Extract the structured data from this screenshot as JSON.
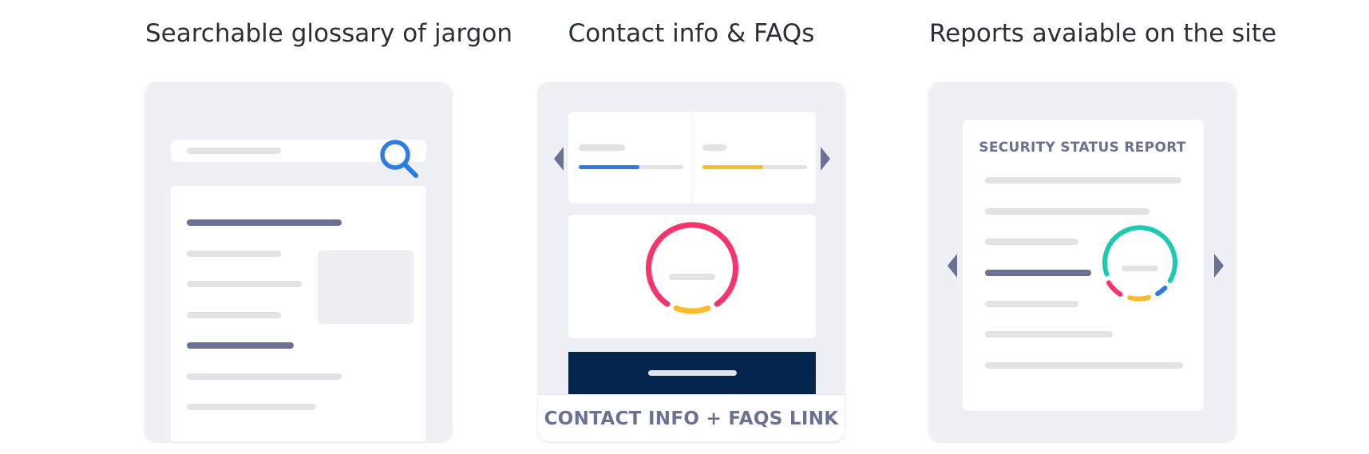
{
  "columns": [
    {
      "title": "Searchable glossary of jargon"
    },
    {
      "title": "Contact info & FAQs",
      "label": "CONTACT INFO + FAQS LINK"
    },
    {
      "title": "Reports avaiable on the site",
      "report_title": "SECURITY STATUS REPORT"
    }
  ],
  "icons": [
    "search-icon",
    "arrow-left-icon",
    "arrow-right-icon",
    "donut-gauge-icon"
  ],
  "colors": {
    "card_bg": "#eef0f5",
    "placeholder_light": "#e1e3e4",
    "placeholder_dark": "#6a7193",
    "blue": "#2f7be5",
    "yellow": "#fbbb2a",
    "pink": "#f7336e",
    "teal": "#1ec9b3",
    "navy": "#04264d"
  }
}
